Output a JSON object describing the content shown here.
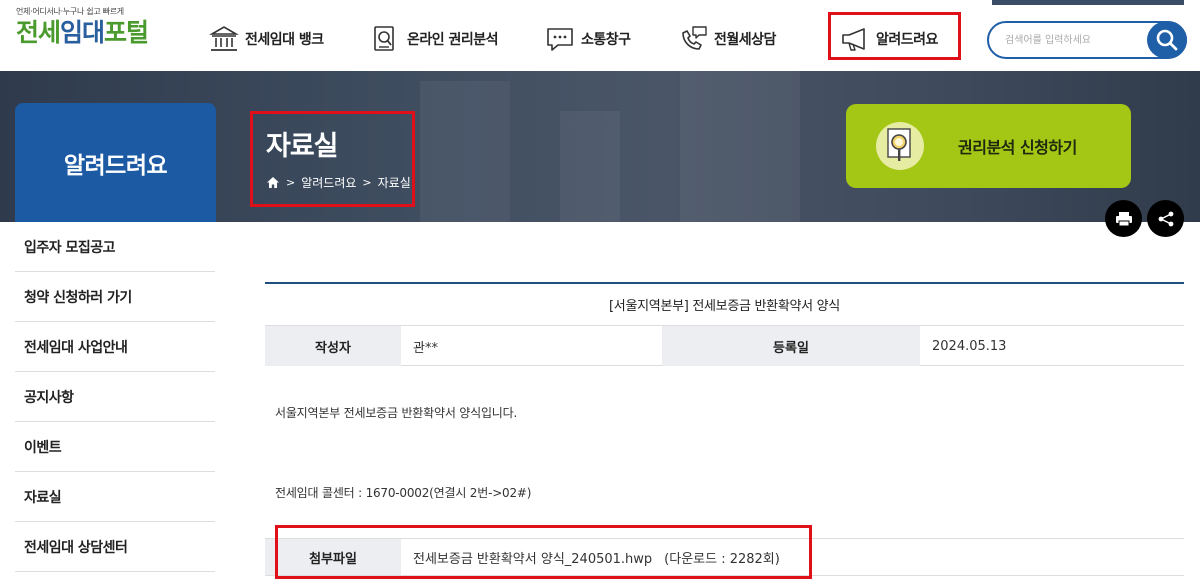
{
  "header": {
    "logo_tagline": "언제·어디서나·누구나 쉽고 빠르게",
    "logo_part1": "전세",
    "logo_part2": "임대",
    "logo_part3": "포털",
    "nav": [
      {
        "label": "전세임대 뱅크",
        "icon": "bank-icon"
      },
      {
        "label": "온라인 권리분석",
        "icon": "document-search-icon"
      },
      {
        "label": "소통창구",
        "icon": "chat-bubble-icon"
      },
      {
        "label": "전월세상담",
        "icon": "phone-chat-icon"
      },
      {
        "label": "알려드려요",
        "icon": "megaphone-icon"
      }
    ],
    "search_placeholder": "검색어를 입력하세요"
  },
  "banner": {
    "section_title": "알려드려요",
    "page_title": "자료실",
    "breadcrumb": [
      "알려드려요",
      "자료실"
    ],
    "apply_button": "권리분석 신청하기"
  },
  "sidebar": {
    "items": [
      {
        "label": "입주자 모집공고"
      },
      {
        "label": "청약 신청하러 가기"
      },
      {
        "label": "전세임대 사업안내"
      },
      {
        "label": "공지사항"
      },
      {
        "label": "이벤트"
      },
      {
        "label": "자료실"
      },
      {
        "label": "전세임대 상담센터"
      }
    ]
  },
  "post": {
    "subject": "[서울지역본부] 전세보증금 반환확약서 양식",
    "author_label": "작성자",
    "author": "관**",
    "date_label": "등록일",
    "date": "2024.05.13",
    "body_line1": "서울지역본부 전세보증금 반환확약서 양식입니다.",
    "body_line2": "전세임대 콜센터 : 1670-0002(연결시 2번->02#)",
    "attach_label": "첨부파일",
    "attach_file": "전세보증금 반환확약서 양식_240501.hwp",
    "attach_downloads": "(다운로드 : 2282회)"
  },
  "colors": {
    "brand_blue": "#1c5aa4",
    "brand_green": "#a4c614",
    "highlight_red": "#e0101a"
  }
}
